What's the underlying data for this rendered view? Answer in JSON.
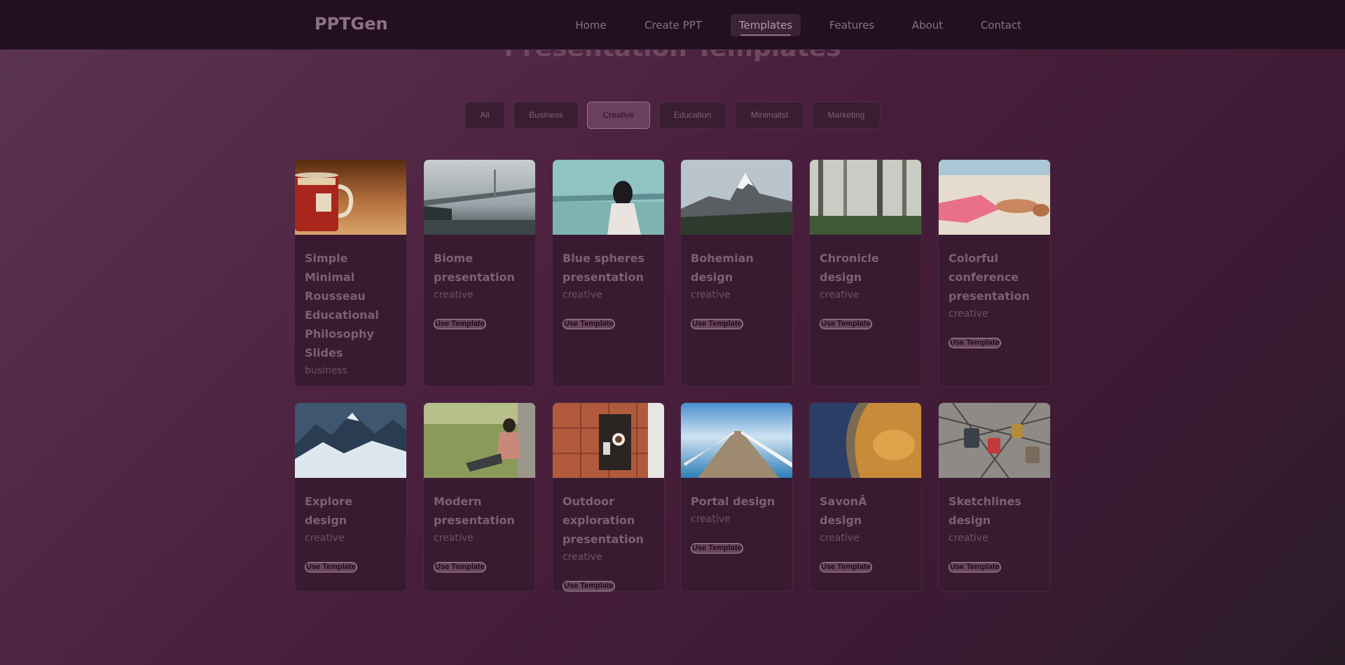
{
  "app": {
    "logo": "PPTGen"
  },
  "nav": [
    {
      "label": "Home",
      "active": false
    },
    {
      "label": "Create PPT",
      "active": false
    },
    {
      "label": "Templates",
      "active": true
    },
    {
      "label": "Features",
      "active": false
    },
    {
      "label": "About",
      "active": false
    },
    {
      "label": "Contact",
      "active": false
    }
  ],
  "page": {
    "title": "Presentation Templates"
  },
  "filters": [
    {
      "label": "All",
      "active": false
    },
    {
      "label": "Business",
      "active": false
    },
    {
      "label": "Creative",
      "active": true
    },
    {
      "label": "Education",
      "active": false
    },
    {
      "label": "Minimalist",
      "active": false
    },
    {
      "label": "Marketing",
      "active": false
    }
  ],
  "use_label": "Use Template",
  "templates": [
    {
      "title": "Simple Minimal Rousseau Educational Philosophy Slides",
      "category": "business",
      "image": "red-mug-photo"
    },
    {
      "title": "Biome presentation",
      "category": "creative",
      "image": "foggy-bridge-photo"
    },
    {
      "title": "Blue spheres presentation",
      "category": "creative",
      "image": "blindfolded-woman-sea-photo"
    },
    {
      "title": "Bohemian design",
      "category": "creative",
      "image": "snowy-peak-photo"
    },
    {
      "title": "Chronicle design",
      "category": "creative",
      "image": "misty-forest-photo"
    },
    {
      "title": "Colorful conference presentation",
      "category": "creative",
      "image": "beach-sunbathers-photo"
    },
    {
      "title": "Explore design",
      "category": "creative",
      "image": "blue-mountains-photo"
    },
    {
      "title": "Modern presentation",
      "category": "creative",
      "image": "man-in-grass-photo"
    },
    {
      "title": "Outdoor exploration presentation",
      "category": "creative",
      "image": "coffee-tiles-photo"
    },
    {
      "title": "Portal design",
      "category": "creative",
      "image": "pier-ocean-photo"
    },
    {
      "title": "SavonÂ design",
      "category": "creative",
      "image": "aerial-terrain-photo"
    },
    {
      "title": "Sketchlines design",
      "category": "creative",
      "image": "love-locks-photo"
    }
  ],
  "colors": {
    "accent": "#6b3f5f",
    "nav_bg": "#23101e",
    "card_bg": "#391a31"
  }
}
